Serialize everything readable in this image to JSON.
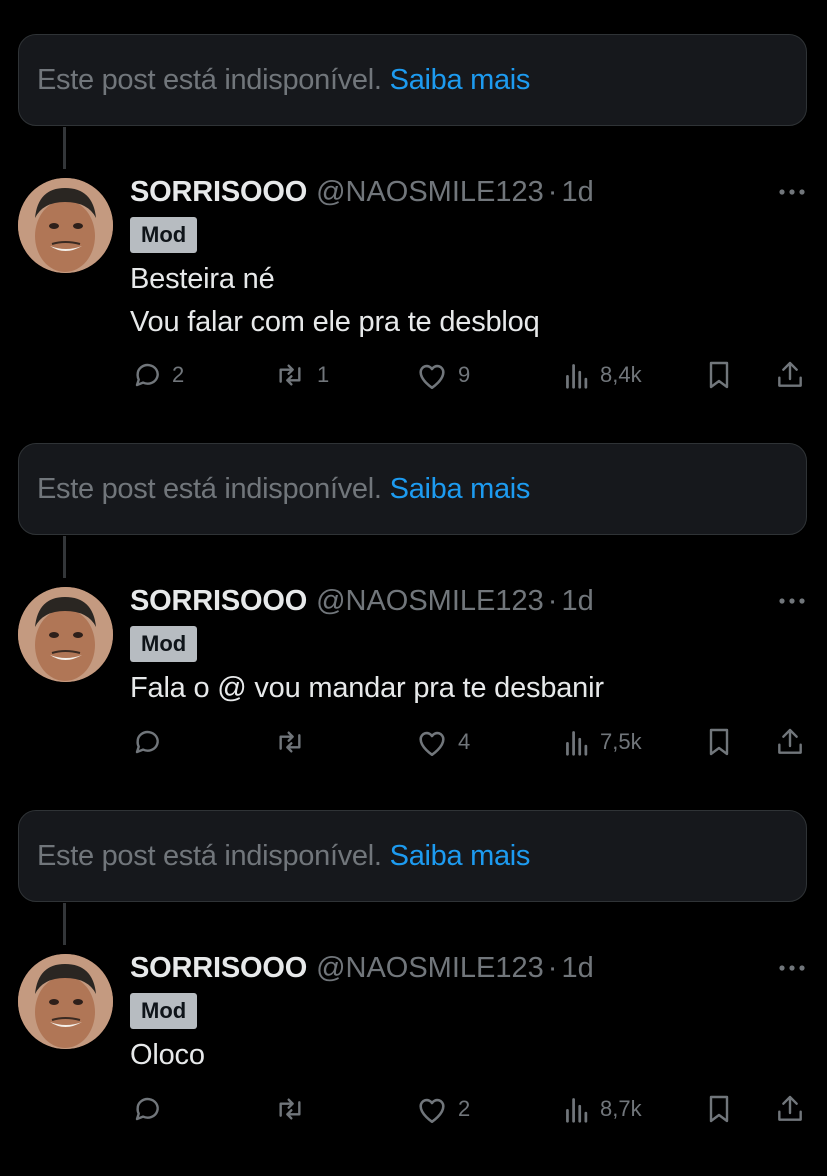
{
  "notice": {
    "text": "Este post está indisponível.",
    "link": "Saiba mais"
  },
  "posts": [
    {
      "name": "SORRISOOO",
      "handle": "@NAOSMILE123",
      "separator": "·",
      "time": "1d",
      "badge": "Mod",
      "lines": [
        "Besteira né",
        "Vou falar com ele pra te desbloq"
      ],
      "replies": "2",
      "reposts": "1",
      "likes": "9",
      "views": "8,4k"
    },
    {
      "name": "SORRISOOO",
      "handle": "@NAOSMILE123",
      "separator": "·",
      "time": "1d",
      "badge": "Mod",
      "lines": [
        "Fala o @ vou mandar pra te desbanir"
      ],
      "replies": "",
      "reposts": "",
      "likes": "4",
      "views": "7,5k"
    },
    {
      "name": "SORRISOOO",
      "handle": "@NAOSMILE123",
      "separator": "·",
      "time": "1d",
      "badge": "Mod",
      "lines": [
        "Oloco"
      ],
      "replies": "",
      "reposts": "",
      "likes": "2",
      "views": "8,7k"
    }
  ],
  "icons": {
    "reply": "reply-icon",
    "repost": "repost-icon",
    "like": "heart-icon",
    "views": "views-icon",
    "bookmark": "bookmark-icon",
    "share": "share-icon",
    "more": "more-icon"
  },
  "colors": {
    "background": "#000000",
    "card": "#16181c",
    "muted": "#71767b",
    "link": "#1d9bf0",
    "text": "#e7e9ea",
    "badge": "#b7bcc1"
  }
}
